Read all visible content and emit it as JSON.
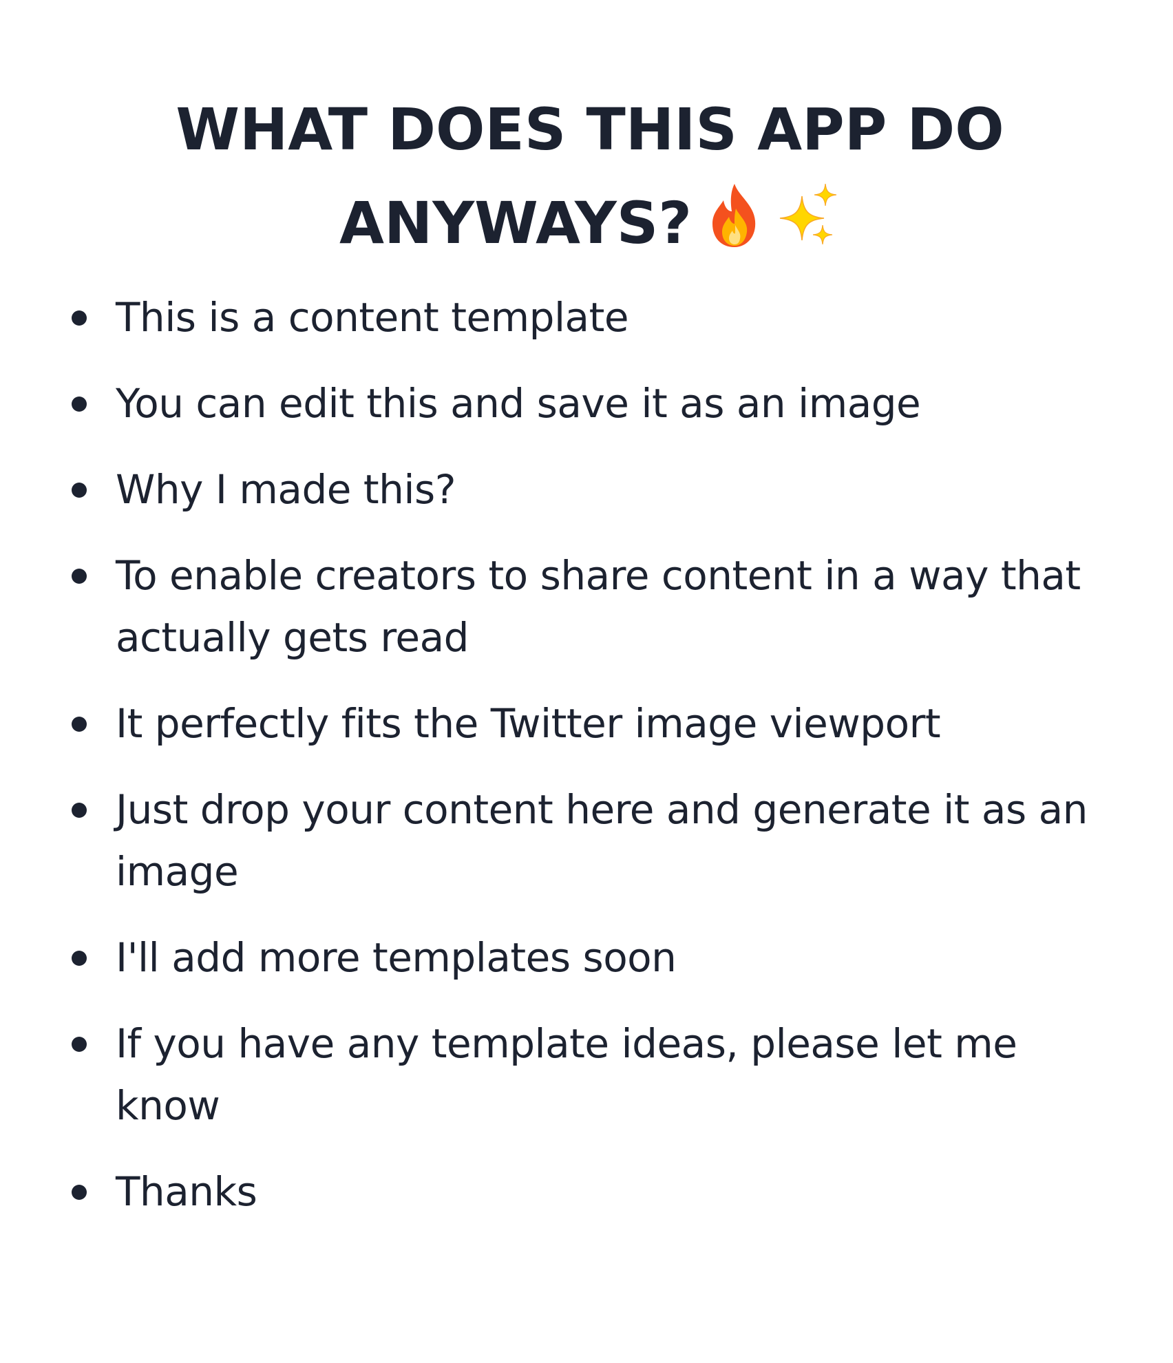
{
  "header": {
    "title": "WHAT DOES THIS APP DO ANYWAYS?",
    "icons": [
      "fire-icon",
      "sparkles-icon"
    ]
  },
  "list": {
    "items": [
      "This is a content template",
      "You can edit this and save it as an image",
      "Why I made this?",
      "To enable creators to share content in a way that actually gets read",
      "It perfectly fits the Twitter image viewport",
      "Just drop your content here and generate it as an image",
      "I'll add more templates soon",
      "If you have any template ideas, please let me know",
      "Thanks"
    ]
  },
  "colors": {
    "text": "#1c2230",
    "background": "#ffffff",
    "fire_outer": "#f4511e",
    "fire_inner": "#ffb300",
    "sparkle": "#ffd600"
  }
}
